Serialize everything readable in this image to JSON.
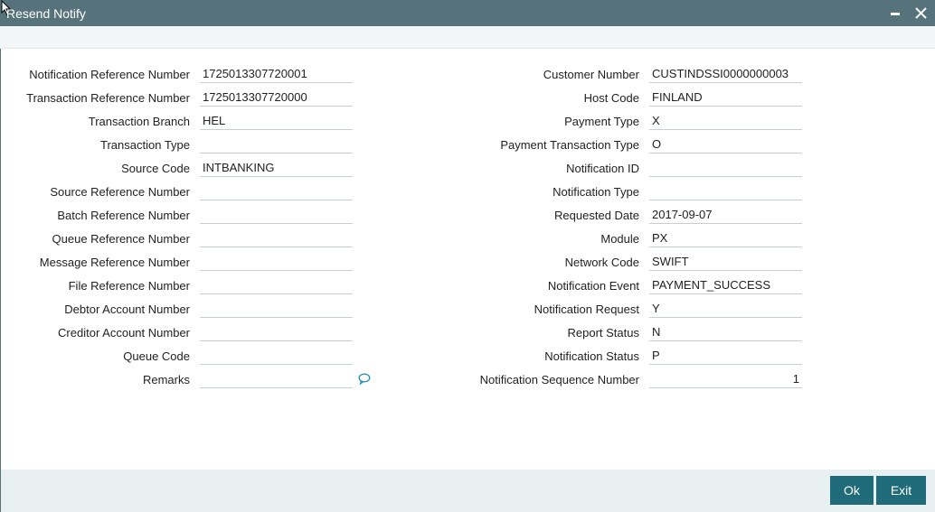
{
  "window": {
    "title": "Resend Notify"
  },
  "left_fields": [
    {
      "label": "Notification Reference Number",
      "value": "1725013307720001"
    },
    {
      "label": "Transaction Reference Number",
      "value": "1725013307720000"
    },
    {
      "label": "Transaction Branch",
      "value": "HEL"
    },
    {
      "label": "Transaction Type",
      "value": ""
    },
    {
      "label": "Source Code",
      "value": "INTBANKING"
    },
    {
      "label": "Source Reference Number",
      "value": ""
    },
    {
      "label": "Batch Reference Number",
      "value": ""
    },
    {
      "label": "Queue Reference Number",
      "value": ""
    },
    {
      "label": "Message Reference Number",
      "value": ""
    },
    {
      "label": "File Reference Number",
      "value": ""
    },
    {
      "label": "Debtor Account Number",
      "value": ""
    },
    {
      "label": "Creditor Account Number",
      "value": ""
    },
    {
      "label": "Queue Code",
      "value": ""
    },
    {
      "label": "Remarks",
      "value": ""
    }
  ],
  "right_fields": [
    {
      "label": "Customer Number",
      "value": "CUSTINDSSI0000000003"
    },
    {
      "label": "Host Code",
      "value": "FINLAND"
    },
    {
      "label": "Payment Type",
      "value": "X"
    },
    {
      "label": "Payment Transaction Type",
      "value": "O"
    },
    {
      "label": "Notification ID",
      "value": ""
    },
    {
      "label": "Notification Type",
      "value": ""
    },
    {
      "label": "Requested Date",
      "value": "2017-09-07"
    },
    {
      "label": "Module",
      "value": "PX"
    },
    {
      "label": "Network Code",
      "value": "SWIFT"
    },
    {
      "label": "Notification Event",
      "value": "PAYMENT_SUCCESS"
    },
    {
      "label": "Notification Request",
      "value": "Y"
    },
    {
      "label": "Report Status",
      "value": "N"
    },
    {
      "label": "Notification Status",
      "value": "P"
    },
    {
      "label": "Notification Sequence Number",
      "value": "1"
    }
  ],
  "buttons": {
    "ok": "Ok",
    "exit": "Exit"
  },
  "icons": {
    "remarks": "chat-bubble-icon",
    "minimize": "minimize-icon",
    "close": "close-icon"
  },
  "colors": {
    "titlebar": "#56737b",
    "button": "#1f6b7a",
    "footer": "#e7eff0"
  }
}
